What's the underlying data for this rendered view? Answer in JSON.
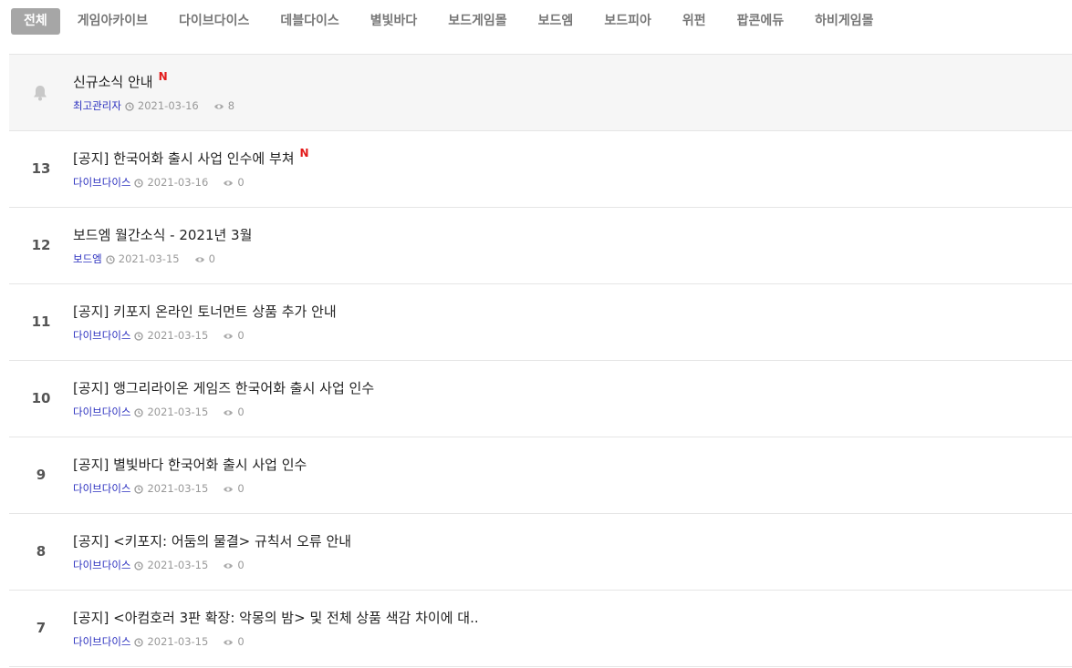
{
  "category_tabs": [
    {
      "label": "전체",
      "active": true
    },
    {
      "label": "게임아카이브",
      "active": false
    },
    {
      "label": "다이브다이스",
      "active": false
    },
    {
      "label": "데블다이스",
      "active": false
    },
    {
      "label": "별빛바다",
      "active": false
    },
    {
      "label": "보드게임몰",
      "active": false
    },
    {
      "label": "보드엠",
      "active": false
    },
    {
      "label": "보드피아",
      "active": false
    },
    {
      "label": "위펀",
      "active": false
    },
    {
      "label": "팝콘에듀",
      "active": false
    },
    {
      "label": "하비게임몰",
      "active": false
    }
  ],
  "posts": [
    {
      "notice": true,
      "icon": "bell-icon",
      "title": "신규소식 안내",
      "new_badge": "N",
      "author": "최고관리자",
      "date": "2021-03-16",
      "views": "8"
    },
    {
      "number": "13",
      "title": "[공지] 한국어화 출시 사업 인수에 부쳐",
      "new_badge": "N",
      "author": "다이브다이스",
      "date": "2021-03-16",
      "views": "0"
    },
    {
      "number": "12",
      "title": "보드엠 월간소식 - 2021년 3월",
      "author": "보드엠",
      "date": "2021-03-15",
      "views": "0"
    },
    {
      "number": "11",
      "title": "[공지] 키포지 온라인 토너먼트 상품 추가 안내",
      "author": "다이브다이스",
      "date": "2021-03-15",
      "views": "0"
    },
    {
      "number": "10",
      "title": "[공지] 앵그리라이온 게임즈 한국어화 출시 사업 인수",
      "author": "다이브다이스",
      "date": "2021-03-15",
      "views": "0"
    },
    {
      "number": "9",
      "title": "[공지] 별빛바다 한국어화 출시 사업 인수",
      "author": "다이브다이스",
      "date": "2021-03-15",
      "views": "0"
    },
    {
      "number": "8",
      "title": "[공지] <키포지: 어둠의 물결> 규칙서 오류 안내",
      "author": "다이브다이스",
      "date": "2021-03-15",
      "views": "0"
    },
    {
      "number": "7",
      "title": "[공지] <아컴호러 3판 확장: 악몽의 밤> 및 전체 상품 색감 차이에 대..",
      "author": "다이브다이스",
      "date": "2021-03-15",
      "views": "0"
    }
  ],
  "colors": {
    "active_tab_bg": "#a6a6a6",
    "author_link": "#2a2fbf",
    "new_badge": "#e31b1b",
    "notice_row_bg": "#f6f6f6"
  }
}
